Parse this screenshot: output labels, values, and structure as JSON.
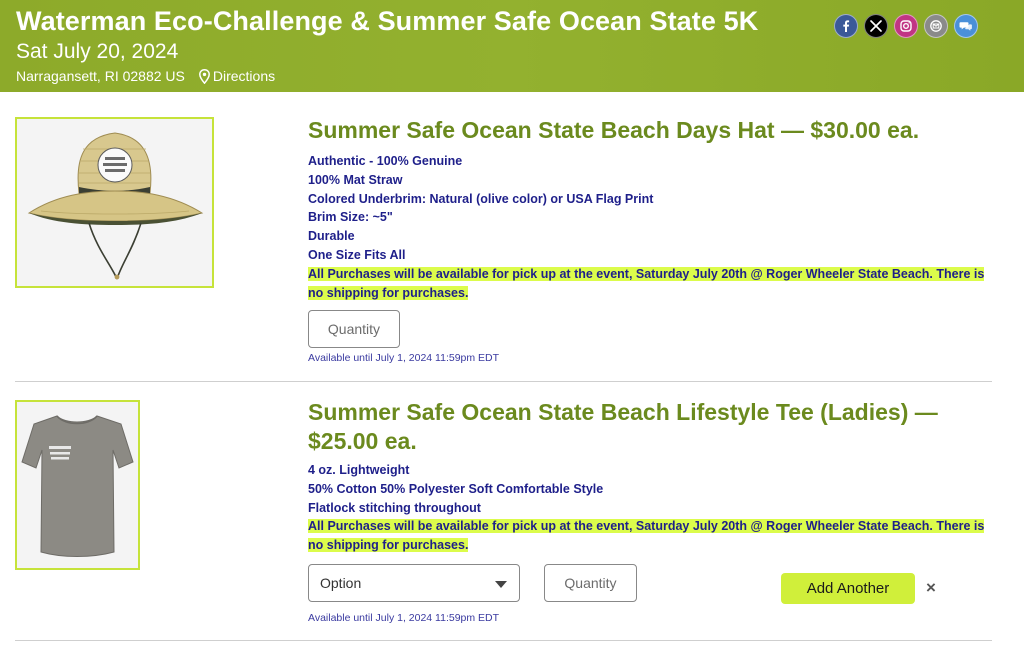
{
  "header": {
    "title": "Waterman Eco-Challenge & Summer Safe Ocean State 5K",
    "date": "Sat July 20, 2024",
    "location": "Narragansett, RI 02882 US",
    "directions_label": "Directions",
    "social": [
      {
        "name": "facebook",
        "icon": "facebook-icon",
        "color": "#3b5998",
        "glyph": "f"
      },
      {
        "name": "x",
        "icon": "x-icon",
        "color": "#000000",
        "glyph": "𝕏"
      },
      {
        "name": "instagram",
        "icon": "instagram-icon",
        "color": "#c13584",
        "glyph": ""
      },
      {
        "name": "email",
        "icon": "email-icon",
        "color": "#8a8a8a",
        "glyph": ""
      },
      {
        "name": "message",
        "icon": "chat-icon",
        "color": "#4a90d9",
        "glyph": ""
      }
    ]
  },
  "products": [
    {
      "title": "Summer Safe Ocean State Beach Days Hat — $30.00 ea.",
      "features": [
        "Authentic - 100% Genuine",
        "100% Mat Straw",
        "Colored Underbrim: Natural (olive color) or USA Flag Print",
        "Brim Size: ~5\"",
        "Durable",
        "One Size Fits All"
      ],
      "note": "All Purchases will be available for pick up at the event, Saturday July 20th @ Roger Wheeler State Beach.  There is no shipping for purchases.",
      "quantity_placeholder": "Quantity",
      "availability": "Available until July 1, 2024 11:59pm EDT"
    },
    {
      "title": "Summer Safe Ocean State Beach Lifestyle Tee (Ladies) — $25.00 ea.",
      "features": [
        "4 oz. Lightweight",
        "50% Cotton 50% Polyester Soft Comfortable Style",
        "Flatlock stitching throughout"
      ],
      "note": "All Purchases will be available for pick up at the event, Saturday July 20th @ Roger Wheeler State Beach.  There is no shipping for purchases.",
      "option_placeholder": "Option",
      "quantity_placeholder": "Quantity",
      "add_another_label": "Add Another",
      "remove_label": "×",
      "availability": "Available until July 1, 2024 11:59pm EDT"
    }
  ],
  "colors": {
    "header_bg": "#8daa2a",
    "title_green": "#6b8a1e",
    "feature_navy": "#1e1f8a",
    "highlight": "#dcfc4b",
    "button_green": "#d0ef3a"
  }
}
